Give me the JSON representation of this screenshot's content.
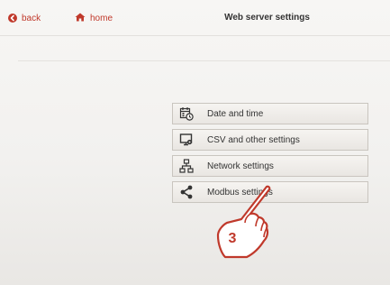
{
  "nav": {
    "back_label": "back",
    "home_label": "home"
  },
  "header": {
    "title": "Web server settings"
  },
  "menu": {
    "items": [
      {
        "label": "Date and time",
        "icon": "calendar-clock-icon"
      },
      {
        "label": "CSV and other settings",
        "icon": "monitor-settings-icon"
      },
      {
        "label": "Network settings",
        "icon": "network-icon"
      },
      {
        "label": "Modbus settings",
        "icon": "share-icon"
      }
    ]
  },
  "annotation": {
    "step_number": "3",
    "color": "#c0392b"
  },
  "colors": {
    "accent": "#c0392b",
    "background": "#f4f3f1",
    "button_border": "#c9c5bf"
  }
}
